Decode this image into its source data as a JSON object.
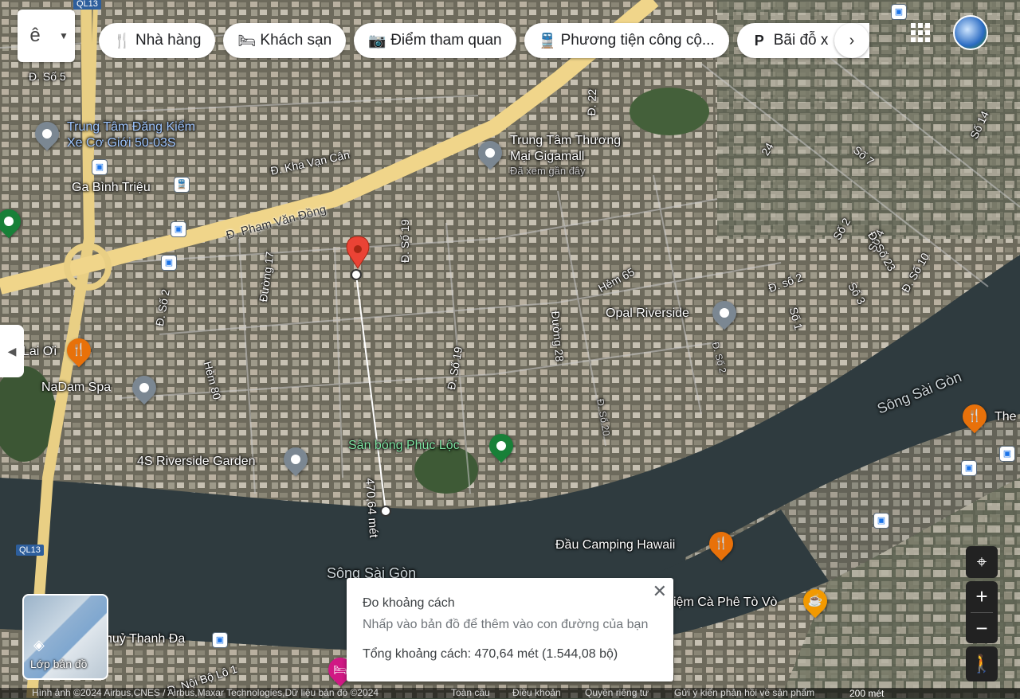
{
  "toolbar": {
    "chips": [
      {
        "icon": "restaurant-icon",
        "glyph": "🍴",
        "label": "Nhà hàng"
      },
      {
        "icon": "hotel-icon",
        "glyph": "🛏",
        "label": "Khách sạn"
      },
      {
        "icon": "camera-icon",
        "glyph": "📷",
        "label": "Điểm tham quan"
      },
      {
        "icon": "transit-icon",
        "glyph": "🚆",
        "label": "Phương tiện công cộ..."
      },
      {
        "icon": "parking-icon",
        "glyph": "P",
        "label": "Bãi đỗ x"
      }
    ],
    "menu_glyph": "ê"
  },
  "map_labels": {
    "roads": {
      "pham_van_dong": "Đ. Phạm Văn Đồng",
      "kha_van_can": "Đ. Kha Vạn Cân",
      "duong_17": "Đường 17",
      "so_19_top": "Đ. Số 19",
      "so_19_mid": "Đ. Số 19",
      "so_2_left": "Đ. Số 2",
      "hem_80": "Hẻm 80",
      "duong_28": "Đường 28",
      "hem_65": "Hẻm 65",
      "so_2_right": "Đ. số 2",
      "so_7": "Số 7",
      "so_4": "Số 4",
      "so_23": "Đ. Số 23",
      "so_10": "Đ. Số 10",
      "so_3": "Số 3",
      "so_1": "Số 1",
      "so_2a": "Số 2",
      "so_14": "Số 14",
      "d_22": "Đ. 22",
      "d_24": "24",
      "so_20": "Đ. Số 20",
      "so_2b": "Đ. Số 2",
      "noi_bo": "Đ. Nội Bộ Lô 1",
      "so_5": "Đ. Số 5",
      "ql13_top": "QL13",
      "ql13_bottom": "QL13"
    },
    "places": {
      "dang_kiem": "Trung Tâm Đăng Kiểm\nXe Cơ Giới 50-03S",
      "ga_binh_trieu": "Ga Bình Triệu",
      "gigamall": "Trung Tâm Thương\nMại Gigamall",
      "gigamall_sub": "Đã xem gần đây",
      "opal": "Opal Riverside",
      "song_sai_gon_1": "Sông Sài Gòn",
      "song_sai_gon_2": "Sông Sài Gòn",
      "nadam": "NaDam Spa",
      "lai_oi": "Lai Ơi",
      "riverside_garden": "4S Riverside Garden",
      "san_bong": "Sân bóng Phúc Lộc",
      "camping": "Đầu Camping Hawaii",
      "ca_phe": "iệm Cà Phê Tò Vò",
      "thanh_da": "huỷ Thanh Đa",
      "the": "The"
    },
    "measure_label": "470,64 mét"
  },
  "measure_panel": {
    "title": "Đo khoảng cách",
    "hint": "Nhấp vào bản đồ để thêm vào con đường của bạn",
    "total": "Tổng khoảng cách: 470,64 mét (1.544,08 bộ)"
  },
  "layers": {
    "label": "Lớp bản đồ"
  },
  "footer": {
    "attribution": "Hình ảnh ©2024 Airbus,CNES / Airbus,Maxar Technologies,Dữ liệu bản đồ ©2024",
    "links": [
      "Toàn cầu",
      "Điều khoản",
      "Quyền riêng tư",
      "Gửi ý kiến phản hồi về sản phẩm"
    ],
    "scale": "200 mét"
  },
  "colors": {
    "water": "#2e3a3e",
    "road_major": "#f0d58a",
    "pin_red": "#ea4335",
    "measure_line": "#ffffff"
  }
}
